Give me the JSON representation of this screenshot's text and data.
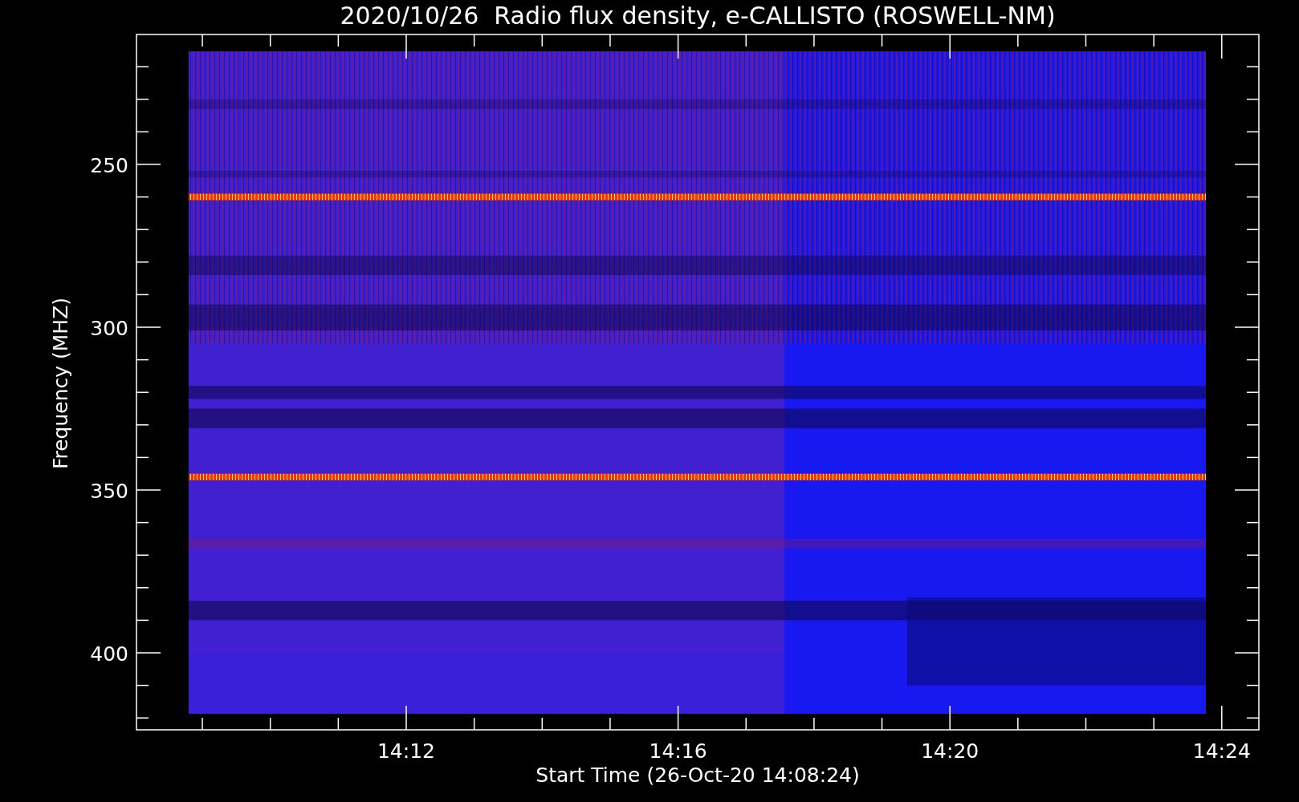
{
  "title": "2020/10/26  Radio flux density, e-CALLISTO (ROSWELL-NM)",
  "y_axis": {
    "label": "Frequency (MHZ)",
    "ticks": [
      "250",
      "300",
      "350",
      "400"
    ]
  },
  "x_axis": {
    "label": "Start Time (26-Oct-20 14:08:24)",
    "ticks": [
      "14:12",
      "14:16",
      "14:20",
      "14:24"
    ]
  }
}
